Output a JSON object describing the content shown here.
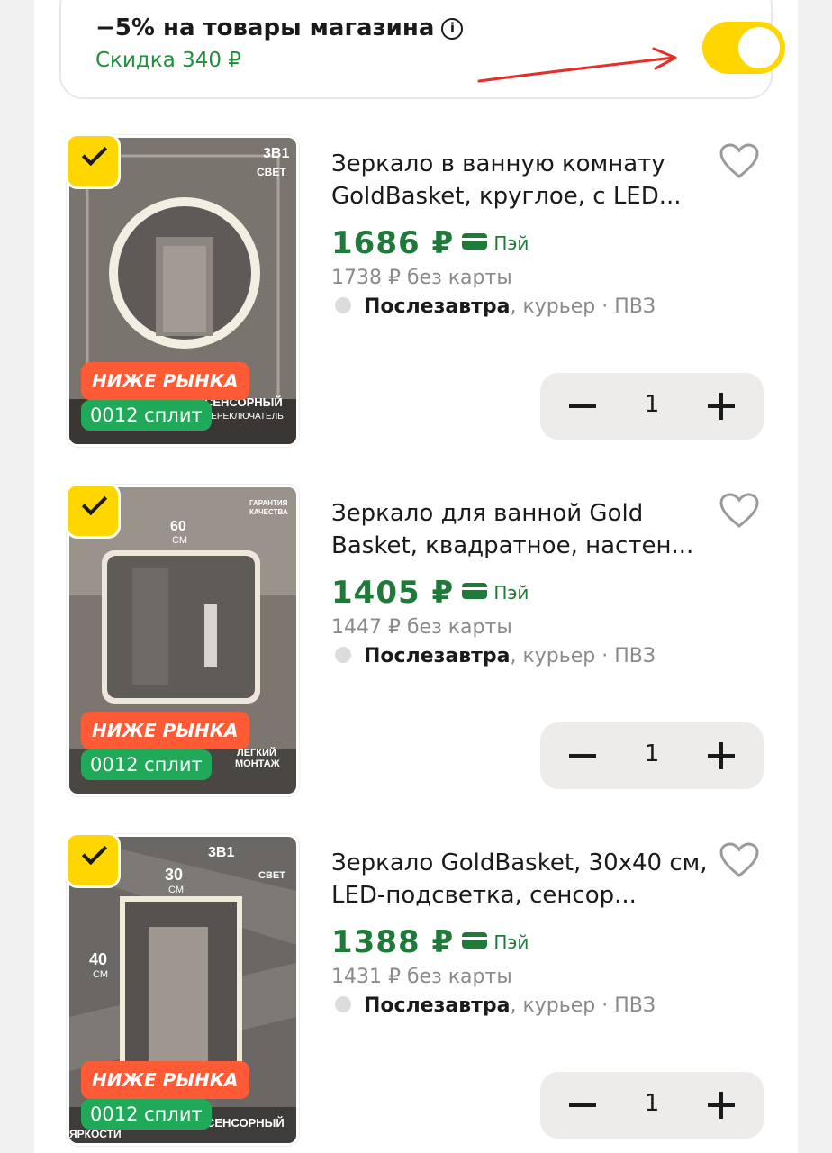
{
  "promo": {
    "title": "−5% на товары магазина",
    "info_icon": "i",
    "subtitle": "Скидка 340 ₽",
    "toggle_on": true
  },
  "items": [
    {
      "title": "Зеркало в ванную комнату GoldBasket, круглое, с LED...",
      "price": "1686 ₽",
      "pay_label": "Пэй",
      "old_price": "1738 ₽ без карты",
      "delivery_day": "Послезавтра",
      "delivery_rest": ", курьер · ПВЗ",
      "badge_market": "НИЖЕ РЫНКА",
      "badge_split": "0012 сплит",
      "quantity": "1",
      "selected": true
    },
    {
      "title": "Зеркало для ванной Gold Basket, квадратное, настен...",
      "price": "1405 ₽",
      "pay_label": "Пэй",
      "old_price": "1447 ₽ без карты",
      "delivery_day": "Послезавтра",
      "delivery_rest": ", курьер · ПВЗ",
      "badge_market": "НИЖЕ РЫНКА",
      "badge_split": "0012 сплит",
      "quantity": "1",
      "selected": true
    },
    {
      "title": "Зеркало GoldBasket, 30х40 см, LED-подсветка, сенсор...",
      "price": "1388 ₽",
      "pay_label": "Пэй",
      "old_price": "1431 ₽ без карты",
      "delivery_day": "Послезавтра",
      "delivery_rest": ", курьер · ПВЗ",
      "badge_market": "НИЖЕ РЫНКА",
      "badge_split": "0012 сплит",
      "quantity": "1",
      "selected": true
    }
  ],
  "colors": {
    "accent": "#ffd600",
    "price_green": "#1f7a3a",
    "badge_red": "#ff5a36",
    "badge_green": "#21a95a"
  }
}
